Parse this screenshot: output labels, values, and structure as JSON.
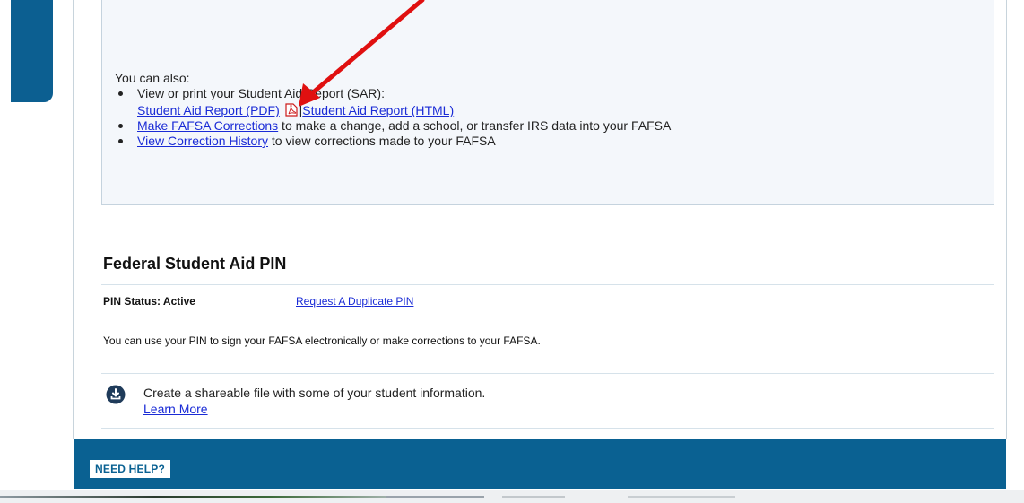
{
  "also": {
    "title": "You can also:",
    "items": [
      {
        "text": "View or print your Student Aid Report (SAR):",
        "links": [
          "Student Aid Report (PDF)",
          "Student Aid Report (HTML)"
        ],
        "separator": "|"
      },
      {
        "link": "Make FAFSA Corrections",
        "text": " to make a change, add a school, or transfer IRS data into your FAFSA"
      },
      {
        "link": "View Correction History",
        "text": " to view corrections made to your FAFSA"
      }
    ]
  },
  "pin": {
    "heading": "Federal Student Aid PIN",
    "status_label": "PIN Status: Active",
    "duplicate_link": "Request A Duplicate PIN",
    "description": "You can use your PIN to sign your FAFSA electronically or make corrections to your FAFSA."
  },
  "share": {
    "text": "Create a shareable file with some of your student information.",
    "link": "Learn More",
    "icon": "download-circle-icon"
  },
  "footer": {
    "need_help": "NEED HELP?"
  },
  "colors": {
    "brand_blue": "#0a6192",
    "link": "#1a2bd6",
    "annotation_arrow": "#e01010"
  }
}
